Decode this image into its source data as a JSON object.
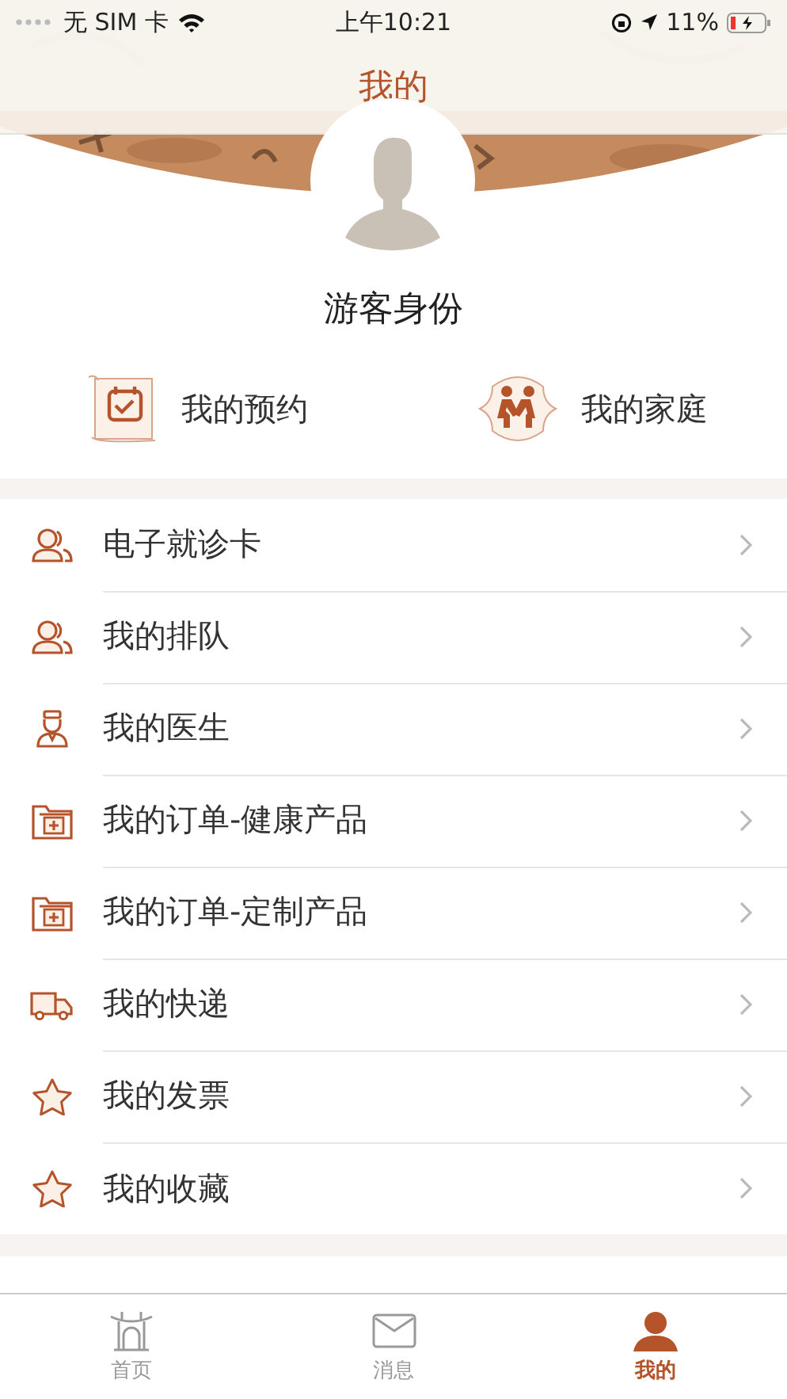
{
  "status_bar": {
    "carrier": "无 SIM 卡",
    "time": "上午10:21",
    "battery": "11%"
  },
  "nav": {
    "title": "我的"
  },
  "profile": {
    "name": "游客身份"
  },
  "shortcuts": [
    {
      "kind": "scroll",
      "label": "我的预约"
    },
    {
      "kind": "family",
      "label": "我的家庭"
    }
  ],
  "menu": [
    {
      "kind": "people",
      "label": "电子就诊卡"
    },
    {
      "kind": "people",
      "label": "我的排队"
    },
    {
      "kind": "doctor",
      "label": "我的医生"
    },
    {
      "kind": "folder",
      "label": "我的订单-健康产品"
    },
    {
      "kind": "folder",
      "label": "我的订单-定制产品"
    },
    {
      "kind": "truck",
      "label": "我的快递"
    },
    {
      "kind": "star",
      "label": "我的发票"
    },
    {
      "kind": "star",
      "label": "我的收藏"
    }
  ],
  "tabs": [
    {
      "kind": "home",
      "label": "首页",
      "selected": false
    },
    {
      "kind": "mail",
      "label": "消息",
      "selected": false
    },
    {
      "kind": "person",
      "label": "我的",
      "selected": true
    }
  ]
}
